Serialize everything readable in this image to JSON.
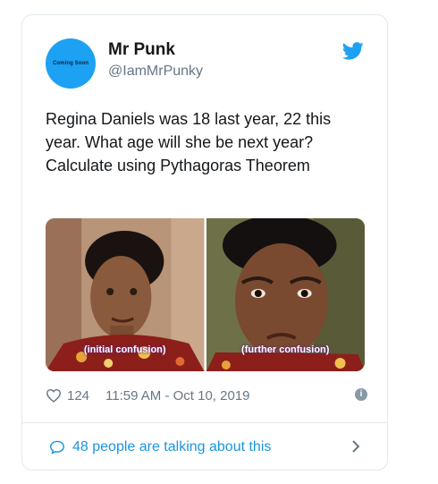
{
  "tweet": {
    "author_name": "Mr Punk",
    "handle": "@IamMrPunky",
    "avatar_text": "Coming Soon",
    "text": "Regina Daniels was 18 last year, 22 this year. What age will she be next year? Calculate using Pythagoras Theorem",
    "media": {
      "left_caption": "(initial confusion)",
      "right_caption": "(further confusion)"
    },
    "likes": "124",
    "timestamp": "11:59 AM - Oct 10, 2019",
    "talking": "48 people are talking about this"
  },
  "icons": [
    "twitter-bird-icon",
    "heart-icon",
    "info-icon",
    "comment-bubble-icon",
    "chevron-right-icon"
  ],
  "colors": {
    "brand": "#1da1f2",
    "link": "#1b95e0",
    "muted": "#657786"
  }
}
